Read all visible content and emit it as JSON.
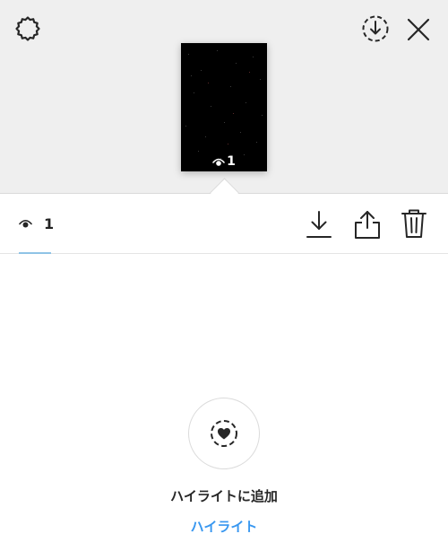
{
  "story_preview": {
    "view_count": "1"
  },
  "stats": {
    "view_count": "1"
  },
  "highlight": {
    "add_label": "ハイライトに追加",
    "link_label": "ハイライト"
  },
  "icons": {
    "top_left": "settings-gear-icon",
    "download_circle": "download-circle-icon",
    "close": "close-icon",
    "eye": "eye-icon",
    "download": "download-icon",
    "share": "share-icon",
    "trash": "trash-icon",
    "highlight_heart": "highlight-heart-icon"
  },
  "colors": {
    "accent_blue": "#3897f0",
    "tab_underline": "#8fc3e6",
    "top_background": "#efefef"
  }
}
